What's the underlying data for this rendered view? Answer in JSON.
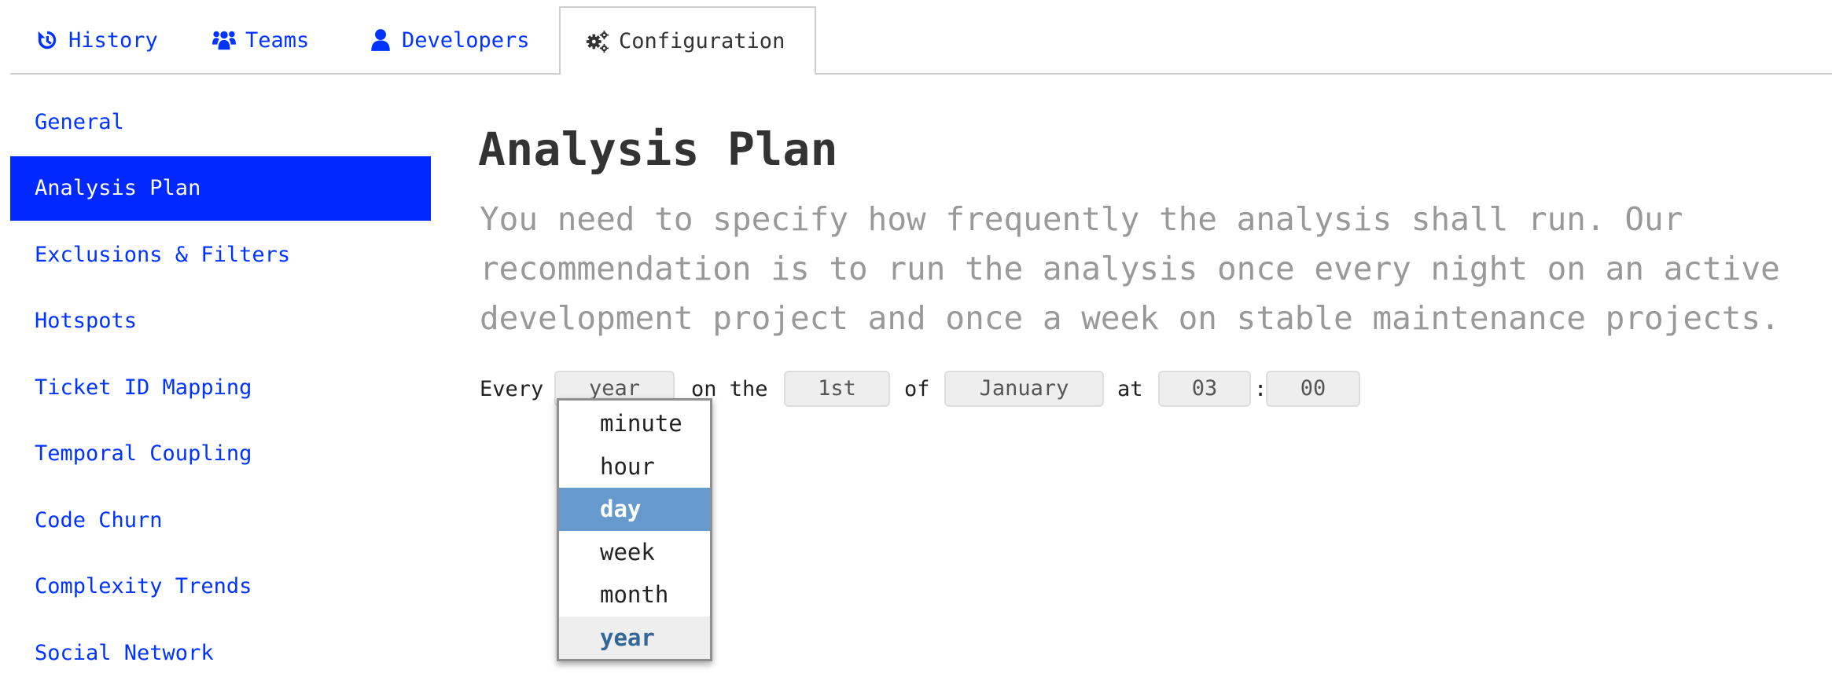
{
  "tabs": [
    {
      "label": "History",
      "icon": "history-icon",
      "active": false
    },
    {
      "label": "Teams",
      "icon": "users-icon",
      "active": false
    },
    {
      "label": "Developers",
      "icon": "user-icon",
      "active": false
    },
    {
      "label": "Configuration",
      "icon": "gears-icon",
      "active": true
    }
  ],
  "sidebar": {
    "items": [
      {
        "label": "General",
        "active": false
      },
      {
        "label": "Analysis Plan",
        "active": true
      },
      {
        "label": "Exclusions & Filters",
        "active": false
      },
      {
        "label": "Hotspots",
        "active": false
      },
      {
        "label": "Ticket ID Mapping",
        "active": false
      },
      {
        "label": "Temporal Coupling",
        "active": false
      },
      {
        "label": "Code Churn",
        "active": false
      },
      {
        "label": "Complexity Trends",
        "active": false
      },
      {
        "label": "Social Network",
        "active": false
      }
    ]
  },
  "main": {
    "title": "Analysis Plan",
    "description_lines": [
      "You need to specify how frequently the analysis shall run. Our",
      "recommendation is to run the analysis once every night on an active",
      "development project and once a week on stable maintenance projects."
    ]
  },
  "schedule": {
    "every_label": "Every",
    "on_the_label": "on the",
    "of_label": "of",
    "at_label": "at",
    "time_separator": ":",
    "period_value": "year",
    "day_value": "1st",
    "month_value": "January",
    "hour_value": "03",
    "minute_value": "00"
  },
  "period_dropdown": {
    "options": [
      "minute",
      "hour",
      "day",
      "week",
      "month",
      "year"
    ],
    "highlighted": "day",
    "selected": "year"
  },
  "colors": {
    "link": "#0033ff",
    "active_sidebar_bg": "#0028ff",
    "dropdown_highlight": "#6699cc",
    "dropdown_selected_text": "#336699",
    "description_text": "#999999"
  }
}
